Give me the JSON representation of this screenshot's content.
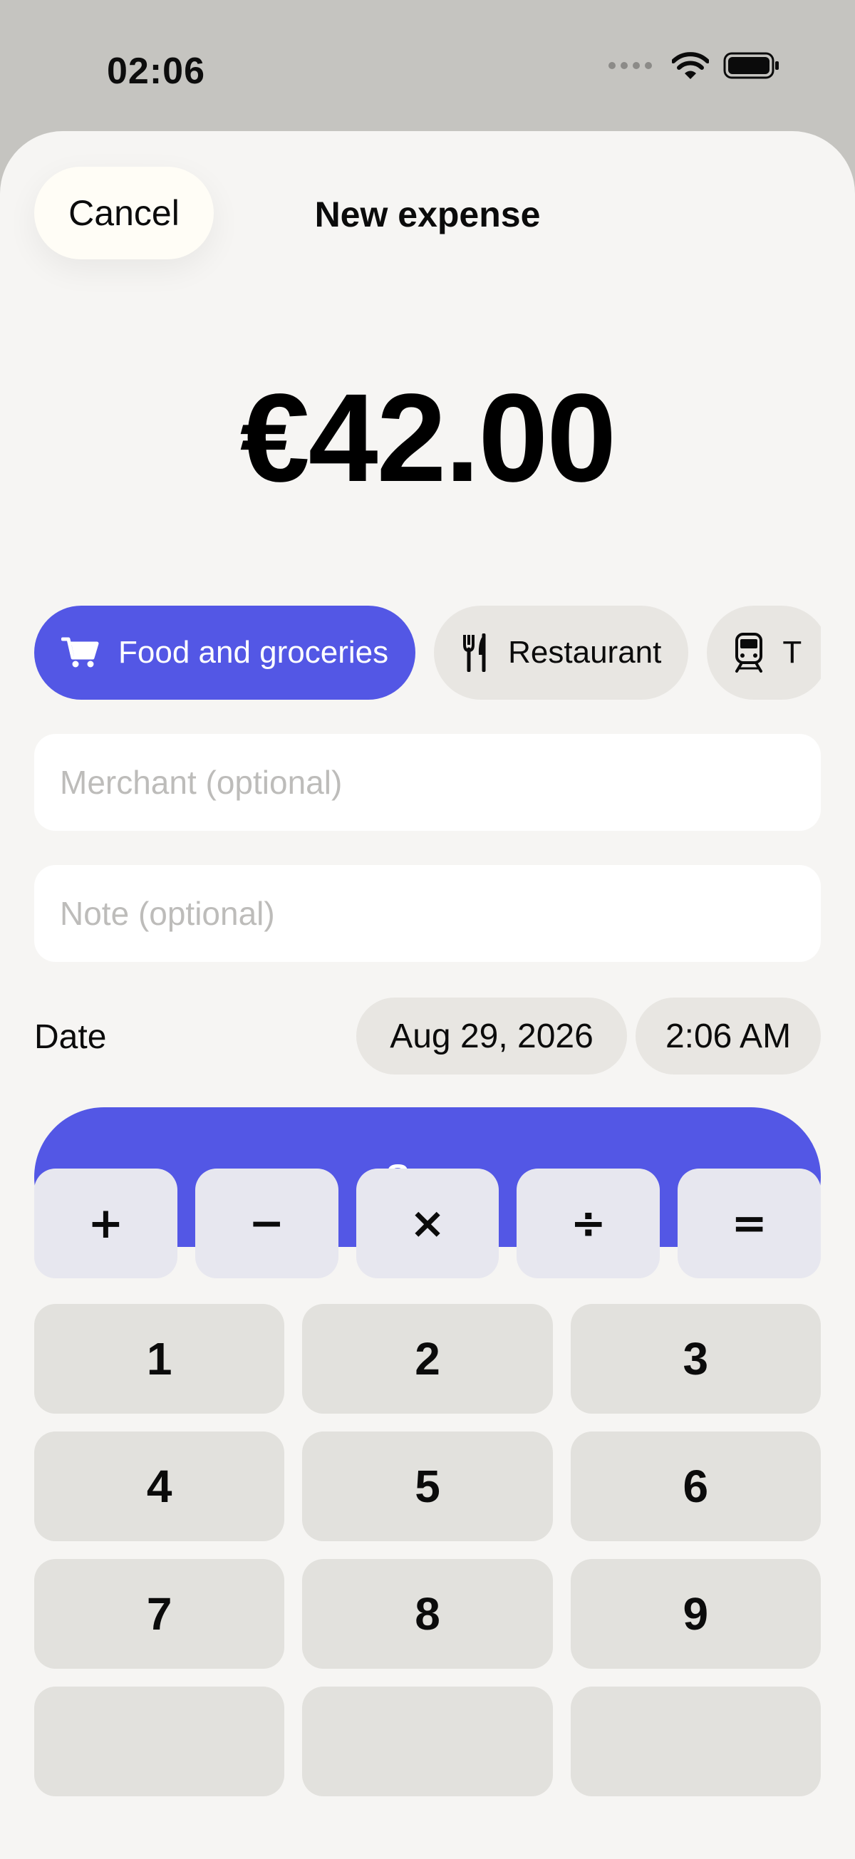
{
  "status_bar": {
    "time": "02:06",
    "icons": [
      "signal-icon",
      "wifi-icon",
      "battery-icon"
    ]
  },
  "header": {
    "cancel_label": "Cancel",
    "title": "New expense"
  },
  "amount": {
    "display": "€42.00"
  },
  "categories": [
    {
      "label": "Food and groceries",
      "icon": "cart-icon",
      "selected": true
    },
    {
      "label": "Restaurant",
      "icon": "fork-knife-icon",
      "selected": false
    },
    {
      "label": "T",
      "icon": "train-icon",
      "selected": false
    }
  ],
  "form": {
    "merchant_placeholder": "Merchant (optional)",
    "merchant_value": "",
    "note_placeholder": "Note (optional)",
    "note_value": "",
    "date_label": "Date",
    "date_value": "Aug 29, 2026",
    "time_value": "2:06 AM"
  },
  "save_label": "Save",
  "keypad": {
    "operators": [
      "+",
      "−",
      "×",
      "÷",
      "="
    ],
    "digits": [
      "1",
      "2",
      "3",
      "4",
      "5",
      "6",
      "7",
      "8",
      "9",
      "",
      "",
      ""
    ]
  },
  "colors": {
    "accent": "#5357e5",
    "sheet_bg": "#f6f5f3",
    "chip_bg": "#e8e6e2",
    "operator_key_bg": "#e7e7ef",
    "digit_key_bg": "#e2e1dd"
  }
}
